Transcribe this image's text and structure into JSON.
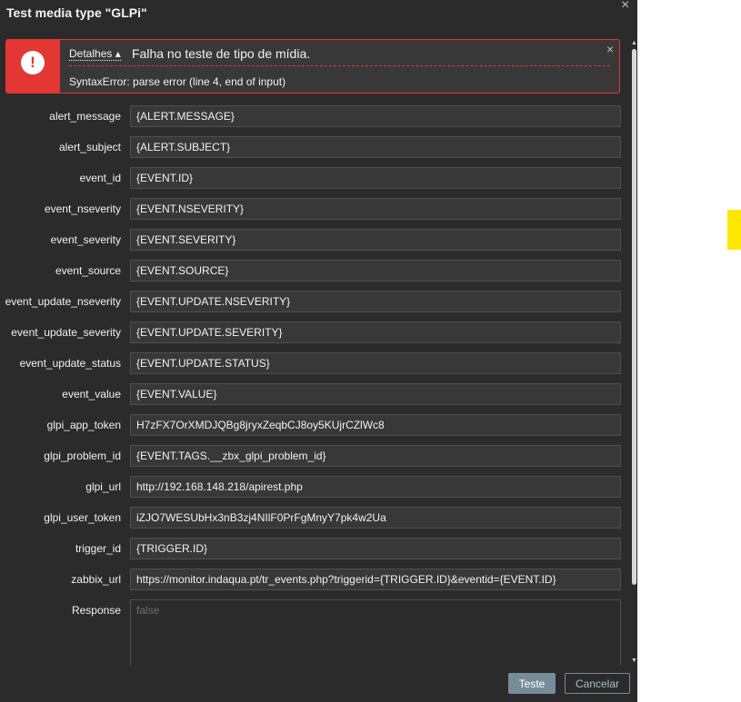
{
  "dialog": {
    "title": "Test media type \"GLPi\"",
    "close_glyph": "×"
  },
  "error": {
    "icon_glyph": "!",
    "details_label": "Detalhes ▴",
    "message": "Falha no teste de tipo de mídia.",
    "close_glyph": "×",
    "detail": "SyntaxError: parse error (line 4, end of input)",
    "color": "#e33734"
  },
  "params": [
    {
      "name": "alert_message",
      "value": "{ALERT.MESSAGE}"
    },
    {
      "name": "alert_subject",
      "value": "{ALERT.SUBJECT}"
    },
    {
      "name": "event_id",
      "value": "{EVENT.ID}"
    },
    {
      "name": "event_nseverity",
      "value": "{EVENT.NSEVERITY}"
    },
    {
      "name": "event_severity",
      "value": "{EVENT.SEVERITY}"
    },
    {
      "name": "event_source",
      "value": "{EVENT.SOURCE}"
    },
    {
      "name": "event_update_nseverity",
      "value": "{EVENT.UPDATE.NSEVERITY}"
    },
    {
      "name": "event_update_severity",
      "value": "{EVENT.UPDATE.SEVERITY}"
    },
    {
      "name": "event_update_status",
      "value": "{EVENT.UPDATE.STATUS}"
    },
    {
      "name": "event_value",
      "value": "{EVENT.VALUE}"
    },
    {
      "name": "glpi_app_token",
      "value": "H7zFX7OrXMDJQBg8jryxZeqbCJ8oy5KUjrCZlWc8"
    },
    {
      "name": "glpi_problem_id",
      "value": "{EVENT.TAGS.__zbx_glpi_problem_id}"
    },
    {
      "name": "glpi_url",
      "value": "http://192.168.148.218/apirest.php"
    },
    {
      "name": "glpi_user_token",
      "value": "iZJO7WESUbHx3nB3zj4NIlF0PrFgMnyY7pk4w2Ua"
    },
    {
      "name": "trigger_id",
      "value": "{TRIGGER.ID}"
    },
    {
      "name": "zabbix_url",
      "value": "https://monitor.indaqua.pt/tr_events.php?triggerid={TRIGGER.ID}&eventid={EVENT.ID}"
    }
  ],
  "response": {
    "label": "Response",
    "placeholder": "false"
  },
  "buttons": {
    "test_label": "Teste",
    "cancel_label": "Cancelar"
  },
  "scrollbar": {
    "up_glyph": "▲",
    "down_glyph": "▼"
  }
}
